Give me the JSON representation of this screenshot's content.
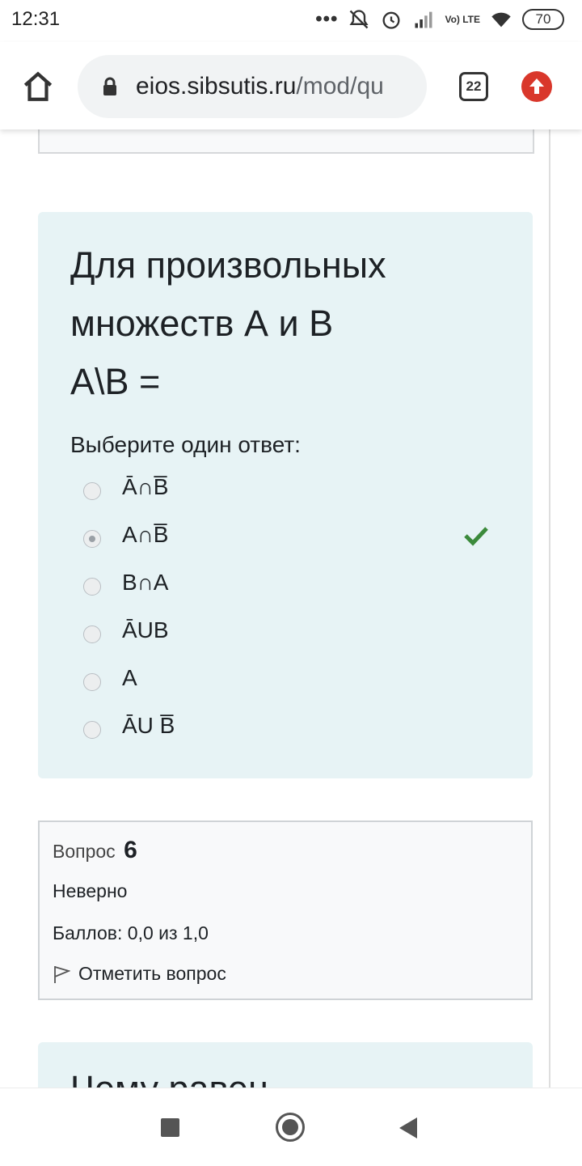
{
  "status_bar": {
    "time": "12:31",
    "network_label": "Vo) LTE",
    "battery": "70",
    "icons": [
      "more-dots-icon",
      "alarm-off-icon",
      "alarm-icon",
      "signal-icon",
      "wifi-icon",
      "battery-icon"
    ]
  },
  "browser": {
    "url_domain": "eios.sibsutis.ru",
    "url_path": "/mod/qu",
    "tab_count": "22",
    "icons": [
      "home-icon",
      "lock-icon",
      "tabs-icon",
      "update-icon"
    ]
  },
  "question": {
    "text_lines": [
      "Для произвольных",
      "множеств А и В",
      "А\\В ="
    ],
    "prompt": "Выберите один ответ:",
    "answers": [
      {
        "label": "Ā∩B̅",
        "checked": false
      },
      {
        "label": "A∩B̅",
        "checked": true,
        "correct": true
      },
      {
        "label": "B∩A",
        "checked": false
      },
      {
        "label": "ĀUB",
        "checked": false
      },
      {
        "label": "A",
        "checked": false
      },
      {
        "label": "ĀU B̅",
        "checked": false
      }
    ],
    "correct_icon": "checkmark-icon"
  },
  "info": {
    "label": "Вопрос",
    "number": "6",
    "status": "Неверно",
    "grade": "Баллов: 0,0 из 1,0",
    "flag_label": "Отметить вопрос",
    "flag_icon": "flag-icon"
  },
  "next_question": {
    "partial_text": "Чему равен"
  },
  "colors": {
    "card_bg": "#e7f3f5",
    "correct": "#3b8a3b",
    "update_badge": "#d9372b"
  }
}
